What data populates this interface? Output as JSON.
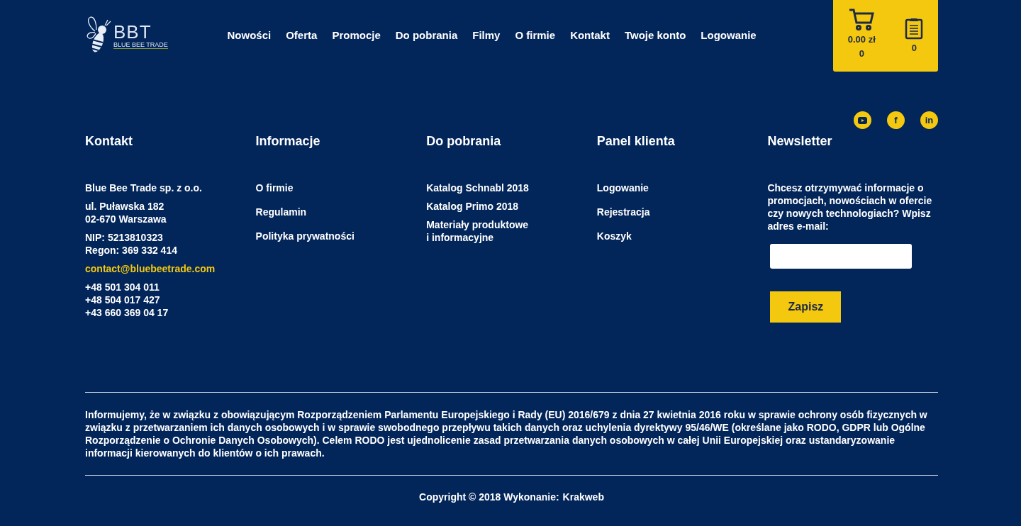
{
  "logo": {
    "mark": "BBT",
    "subtitle": "BLUE BEE TRADE"
  },
  "nav": [
    "Nowości",
    "Oferta",
    "Promocje",
    "Do pobrania",
    "Filmy",
    "O firmie",
    "Kontakt",
    "Twoje konto",
    "Logowanie"
  ],
  "cart": {
    "total": "0.00 zł",
    "count": "0",
    "list_count": "0"
  },
  "social": [
    {
      "kind": "youtube"
    },
    {
      "kind": "facebook",
      "label": "f"
    },
    {
      "kind": "linkedin",
      "label": "in"
    }
  ],
  "contact": {
    "title": "Kontakt",
    "groups": [
      {
        "kind": "company",
        "lines": [
          "Blue Bee Trade sp. z o.o."
        ]
      },
      {
        "kind": "text",
        "lines": [
          "ul. Puławska 182",
          "02-670 Warszawa"
        ]
      },
      {
        "kind": "text",
        "lines": [
          "NIP: 5213810323",
          "Regon: 369 332 414"
        ]
      },
      {
        "kind": "email",
        "lines": [
          "contact@bluebeetrade.com"
        ]
      },
      {
        "kind": "text",
        "lines": [
          "+48 501 304 011",
          "+48 504 017 427",
          "+43 660 369 04 17"
        ]
      }
    ]
  },
  "info": {
    "title": "Informacje",
    "links": [
      [
        "O firmie"
      ],
      [
        "Regulamin"
      ],
      [
        "Polityka prywatności"
      ]
    ]
  },
  "downloads": {
    "title": "Do pobrania",
    "links": [
      [
        "Katalog Schnabl 2018"
      ],
      [
        "Katalog Primo 2018"
      ],
      [
        "Materiały produktowe",
        "i informacyjne"
      ]
    ]
  },
  "client_panel": {
    "title": "Panel klienta",
    "links": [
      [
        "Logowanie"
      ],
      [
        "Rejestracja"
      ],
      [
        "Koszyk"
      ]
    ]
  },
  "newsletter": {
    "title": "Newsletter",
    "text": "Chcesz otrzymywać informacje o promocjach, nowościach w ofercie czy nowych technologiach? Wpisz adres e-mail:",
    "button": "Zapisz"
  },
  "rodo_notice": "Informujemy, że w związku z obowiązującym Rozporządzeniem Parlamentu Europejskiego i Rady (EU) 2016/679 z dnia 27 kwietnia 2016 roku w sprawie ochrony osób fizycznych w związku z przetwarzaniem ich danych osobowych i w sprawie swobodnego przepływu takich danych oraz uchylenia dyrektywy 95/46/WE (określane jako RODO, GDPR lub Ogólne Rozporządzenie o Ochronie Danych Osobowych). Celem RODO jest ujednolicenie zasad przetwarzania danych osobowych w całej Unii Europejskiej oraz ustandaryzowanie informacji kierowanych do klientów o ich prawach.",
  "copyright": {
    "text": "Copyright © 2018 Wykonanie:",
    "link": "Krakweb"
  }
}
